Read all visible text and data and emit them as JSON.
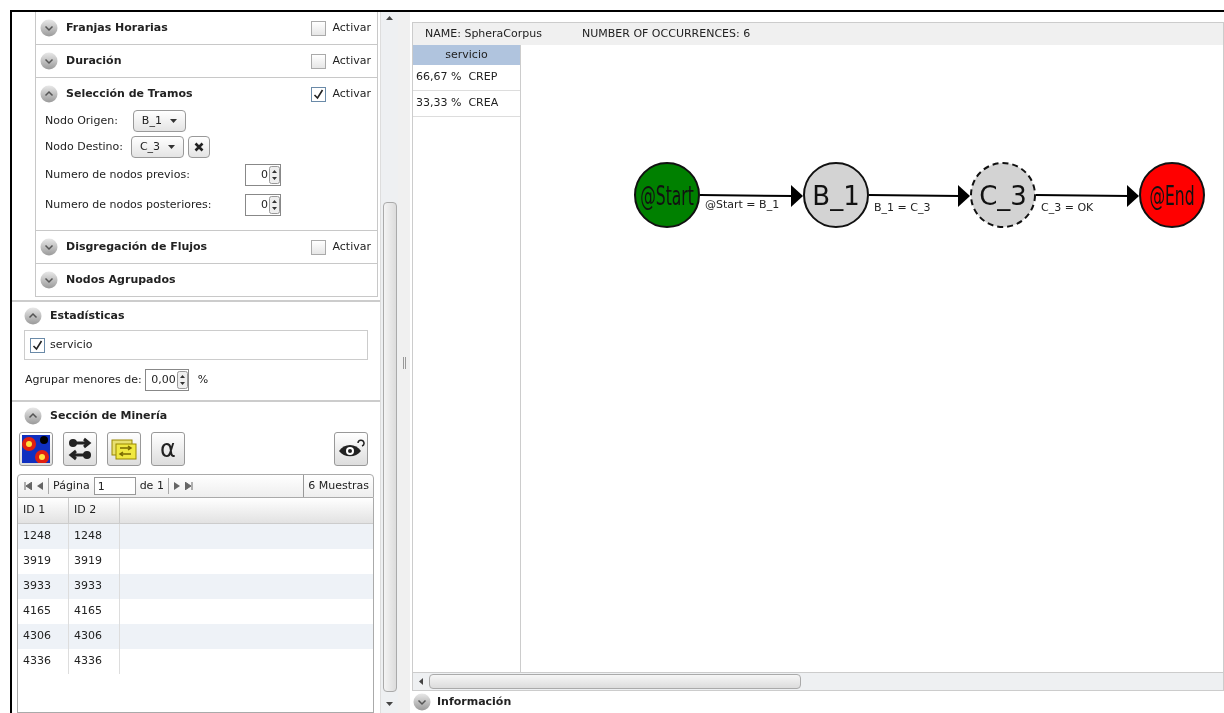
{
  "filters": [
    {
      "title": "Franjas Horarias",
      "expanded": false,
      "activate": {
        "label": "Activar",
        "checked": false
      }
    },
    {
      "title": "Duración",
      "expanded": false,
      "activate": {
        "label": "Activar",
        "checked": false
      }
    },
    {
      "title": "Selección de Tramos",
      "expanded": true,
      "activate": {
        "label": "Activar",
        "checked": true
      },
      "origin": {
        "label": "Nodo Origen:",
        "value": "B_1"
      },
      "destination": {
        "label": "Nodo Destino:",
        "value": "C_3"
      },
      "spinners": [
        {
          "label": "Numero de nodos previos:",
          "value": "0"
        },
        {
          "label": "Numero de nodos posteriores:",
          "value": "0"
        }
      ]
    },
    {
      "title": "Disgregación de Flujos",
      "expanded": false,
      "activate": {
        "label": "Activar",
        "checked": false
      }
    },
    {
      "title": "Nodos Agrupados",
      "expanded": false
    }
  ],
  "statistics": {
    "title": "Estadísticas",
    "expanded": true,
    "items": [
      {
        "label": "servicio",
        "checked": true
      }
    ],
    "group_label": "Agrupar menores de:",
    "group_value": "0,00",
    "group_unit": "%"
  },
  "mining": {
    "title": "Sección de Minería",
    "expanded": true,
    "tools": [
      {
        "kind": "heatmap"
      },
      {
        "kind": "swap"
      },
      {
        "kind": "folder-swap"
      },
      {
        "kind": "text",
        "text": "α"
      }
    ],
    "right_tool": {
      "kind": "eye"
    },
    "pager": {
      "page_label": "Página",
      "page": "1",
      "of": "de 1",
      "count": "6 Muestras"
    },
    "columns": [
      "ID 1",
      "ID 2"
    ],
    "rows": [
      [
        "1248",
        "1248"
      ],
      [
        "3919",
        "3919"
      ],
      [
        "3933",
        "3933"
      ],
      [
        "4165",
        "4165"
      ],
      [
        "4306",
        "4306"
      ],
      [
        "4336",
        "4336"
      ]
    ]
  },
  "info": {
    "name": "NAME: SpheraCorpus",
    "occurrences": "NUMBER OF OCCURRENCES: 6"
  },
  "legend": {
    "header": "servicio",
    "rows": [
      "66,67 %  CREP",
      "33,33 %  CREA"
    ]
  },
  "graph": {
    "nodes": [
      {
        "label": "@Start",
        "color": "#008000",
        "dashed": false
      },
      {
        "label": "B_1",
        "color": "#d3d3d3",
        "dashed": false
      },
      {
        "label": "C_3",
        "color": "#d3d3d3",
        "dashed": true
      },
      {
        "label": "@End",
        "color": "#ff0000",
        "dashed": false
      }
    ],
    "edges": [
      "@Start = B_1",
      "B_1 = C_3",
      "C_3 = OK"
    ]
  },
  "bottom": {
    "title": "Información",
    "expanded": false
  }
}
